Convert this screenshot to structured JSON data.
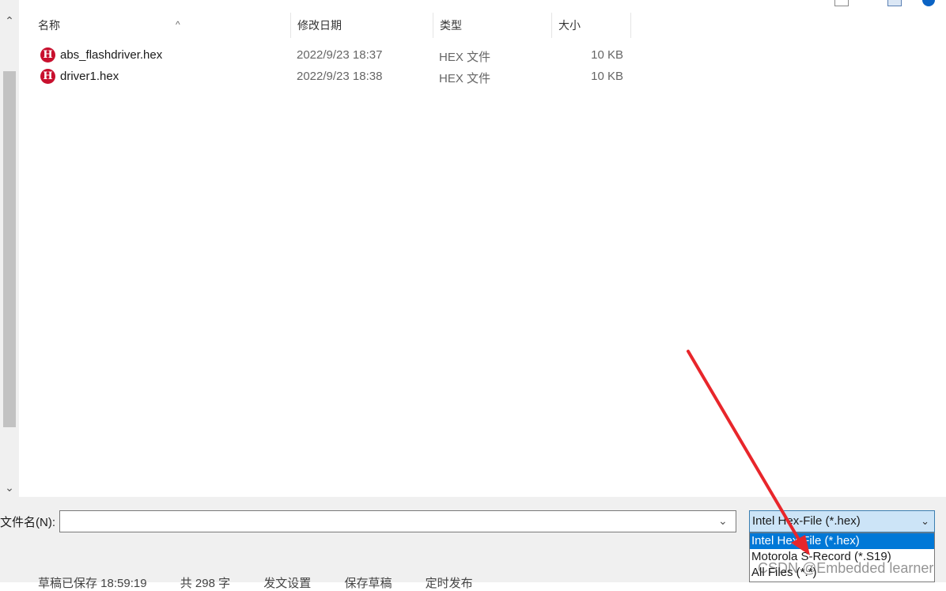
{
  "columns": {
    "name": "名称",
    "date": "修改日期",
    "type": "类型",
    "size": "大小"
  },
  "files": [
    {
      "name": "abs_flashdriver.hex",
      "date": "2022/9/23 18:37",
      "type": "HEX 文件",
      "size": "10 KB",
      "icon": "hex-file-icon"
    },
    {
      "name": "driver1.hex",
      "date": "2022/9/23 18:38",
      "type": "HEX 文件",
      "size": "10 KB",
      "icon": "hex-file-icon"
    }
  ],
  "filename": {
    "label": "文件名(N):",
    "value": ""
  },
  "filetype": {
    "selected": "Intel Hex-File (*.hex)",
    "options": [
      "Intel Hex-File (*.hex)",
      "Motorola S-Record (*.S19)",
      "All Files (*.*)"
    ]
  },
  "background_status": [
    "草稿已保存 18:59:19",
    "共 298 字",
    "发文设置",
    "保存草稿",
    "定时发布"
  ],
  "watermark": "CSDN @Embedded learner",
  "colors": {
    "selection": "#0078d7",
    "annotation_arrow": "#e8262b",
    "hex_icon": "#c8102e"
  }
}
